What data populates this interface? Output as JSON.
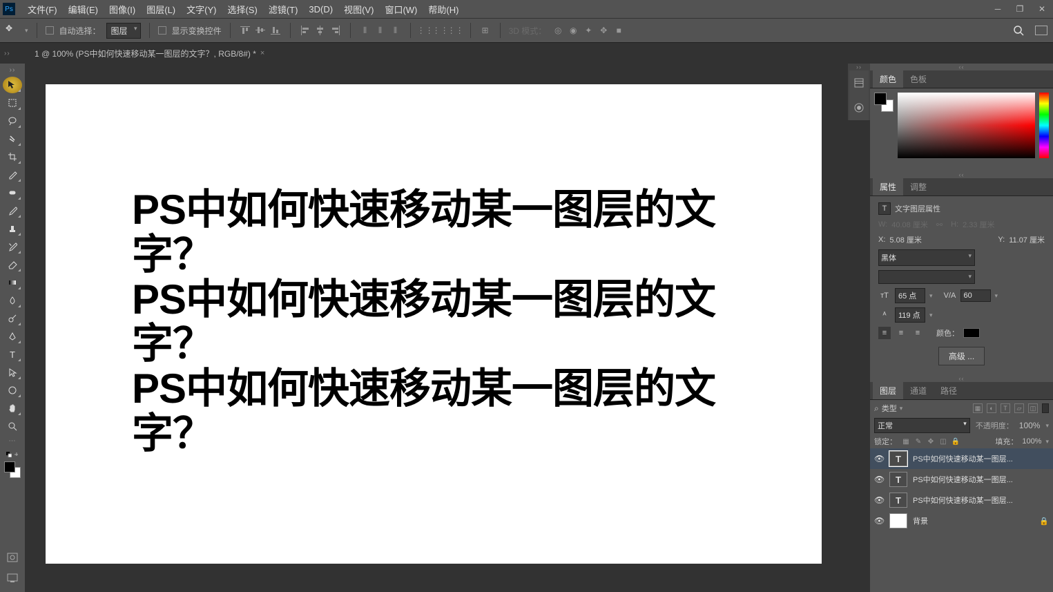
{
  "menus": [
    "文件(F)",
    "编辑(E)",
    "图像(I)",
    "图层(L)",
    "文字(Y)",
    "选择(S)",
    "滤镜(T)",
    "3D(D)",
    "视图(V)",
    "窗口(W)",
    "帮助(H)"
  ],
  "options": {
    "auto_select_label": "自动选择：",
    "auto_select_value": "图层",
    "show_transform": "显示变换控件",
    "mode_3d": "3D 模式："
  },
  "document_tab": "1 @ 100% (PS中如何快速移动某一图层的文字？, RGB/8#) *",
  "canvas_lines": [
    "PS中如何快速移动某一图层的文字？",
    "PS中如何快速移动某一图层的文字？",
    "PS中如何快速移动某一图层的文字？"
  ],
  "panels": {
    "color_tabs": [
      "颜色",
      "色板"
    ],
    "props_tabs": [
      "属性",
      "调整"
    ],
    "props_title": "文字图层属性",
    "w_label": "W:",
    "w_value": "40.08 厘米",
    "h_label": "H:",
    "h_value": "2.33 厘米",
    "x_label": "X:",
    "x_value": "5.08 厘米",
    "y_label": "Y:",
    "y_value": "11.07 厘米",
    "font": "黑体",
    "size": "65 点",
    "tracking": "60",
    "leading": "119 点",
    "color_label": "颜色：",
    "advanced": "高级 ...",
    "layers_tabs": [
      "图层",
      "通道",
      "路径"
    ],
    "filter_label": "类型",
    "blend_mode": "正常",
    "opacity_label": "不透明度：",
    "opacity_value": "100%",
    "lock_label": "锁定：",
    "fill_label": "填充：",
    "fill_value": "100%",
    "layers": [
      {
        "name": "PS中如何快速移动某一图层...",
        "type": "T",
        "selected": true,
        "locked": false
      },
      {
        "name": "PS中如何快速移动某一图层...",
        "type": "T",
        "selected": false,
        "locked": false
      },
      {
        "name": "PS中如何快速移动某一图层...",
        "type": "T",
        "selected": false,
        "locked": false
      },
      {
        "name": "背景",
        "type": "bg",
        "selected": false,
        "locked": true
      }
    ]
  }
}
